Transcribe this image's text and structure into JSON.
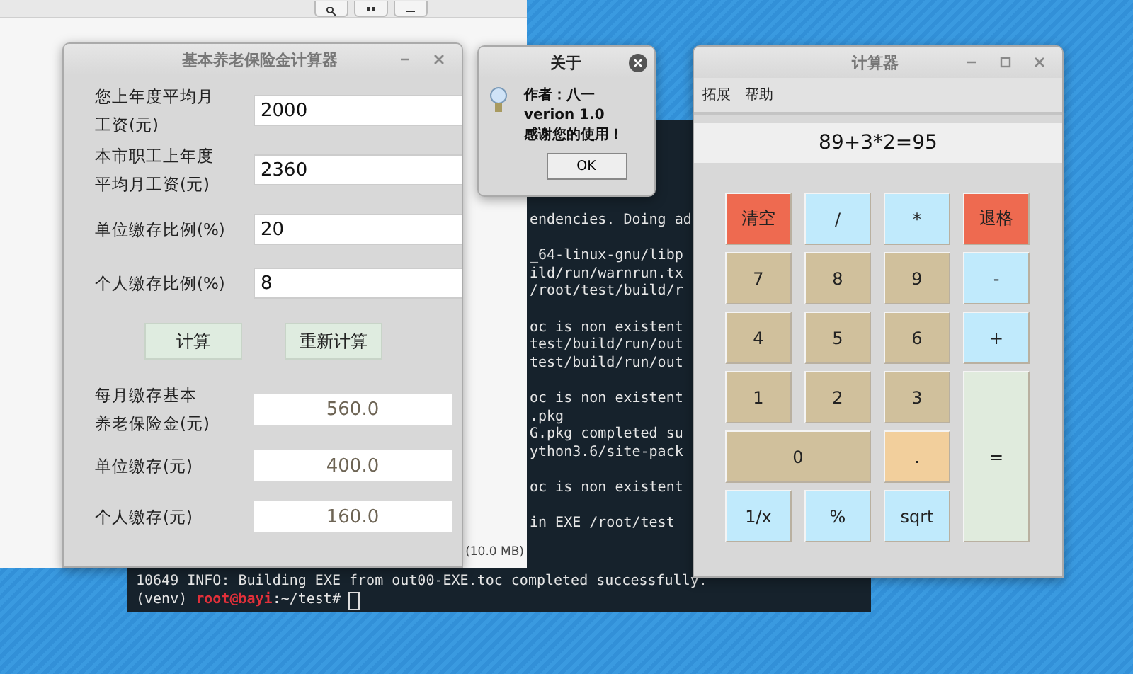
{
  "file_manager": {
    "toolbar_buttons": [
      {
        "kind": "search"
      },
      {
        "kind": "grid"
      },
      {
        "kind": "menu"
      }
    ],
    "status_text": "(10.0 MB)"
  },
  "terminal": {
    "blocks": [
      [
        "endencies. Doing ad"
      ],
      [
        "_64-linux-gnu/libp",
        "ild/run/warnrun.tx",
        "/root/test/build/r"
      ],
      [
        "oc is non existent",
        "test/build/run/out",
        "test/build/run/out"
      ],
      [
        "oc is non existent",
        ".pkg",
        "G.pkg completed su",
        "ython3.6/site-pack"
      ],
      [
        "oc is non existent"
      ],
      [
        "in EXE /root/test"
      ]
    ],
    "full_line": "10649 INFO: Building EXE from out00-EXE.toc completed successfully.",
    "prompt": {
      "env": "(venv)",
      "user": "root@bayi",
      "path": ":~/test#"
    }
  },
  "pension_window": {
    "title": "基本养老保险金计算器",
    "inputs": [
      {
        "label": [
          "您上年度平均月",
          "工资(元)"
        ],
        "value": "2000"
      },
      {
        "label": [
          "本市职工上年度",
          "平均月工资(元)"
        ],
        "value": "2360"
      },
      {
        "label": [
          "单位缴存比例(%)"
        ],
        "value": "20"
      },
      {
        "label": [
          "个人缴存比例(%)"
        ],
        "value": "8"
      }
    ],
    "buttons": [
      "计算",
      "重新计算"
    ],
    "results": [
      {
        "label": [
          "每月缴存基本",
          "养老保险金(元)"
        ],
        "value": "560.0"
      },
      {
        "label": [
          "单位缴存(元)"
        ],
        "value": "400.0"
      },
      {
        "label": [
          "个人缴存(元)"
        ],
        "value": "160.0"
      }
    ]
  },
  "about_dialog": {
    "title": "关于",
    "message": [
      "作者：八一",
      "verion 1.0",
      "感谢您的使用！"
    ],
    "button": "OK"
  },
  "calculator": {
    "title": "计算器",
    "menu": [
      "拓展",
      "帮助"
    ],
    "display": "89+3*2=95",
    "keys": [
      {
        "label": "清空",
        "kind": "danger"
      },
      {
        "label": "/",
        "kind": "op"
      },
      {
        "label": "*",
        "kind": "op"
      },
      {
        "label": "退格",
        "kind": "danger"
      },
      {
        "label": "7",
        "kind": "digit"
      },
      {
        "label": "8",
        "kind": "digit"
      },
      {
        "label": "9",
        "kind": "digit"
      },
      {
        "label": "-",
        "kind": "op"
      },
      {
        "label": "4",
        "kind": "digit"
      },
      {
        "label": "5",
        "kind": "digit"
      },
      {
        "label": "6",
        "kind": "digit"
      },
      {
        "label": "+",
        "kind": "op"
      },
      {
        "label": "1",
        "kind": "digit"
      },
      {
        "label": "2",
        "kind": "digit"
      },
      {
        "label": "3",
        "kind": "digit"
      },
      {
        "label": "0",
        "kind": "zero"
      },
      {
        "label": ".",
        "kind": "dot"
      },
      {
        "label": "=",
        "kind": "equals"
      },
      {
        "label": "1/x",
        "kind": "op"
      },
      {
        "label": "%",
        "kind": "op"
      },
      {
        "label": "sqrt",
        "kind": "op"
      }
    ]
  }
}
